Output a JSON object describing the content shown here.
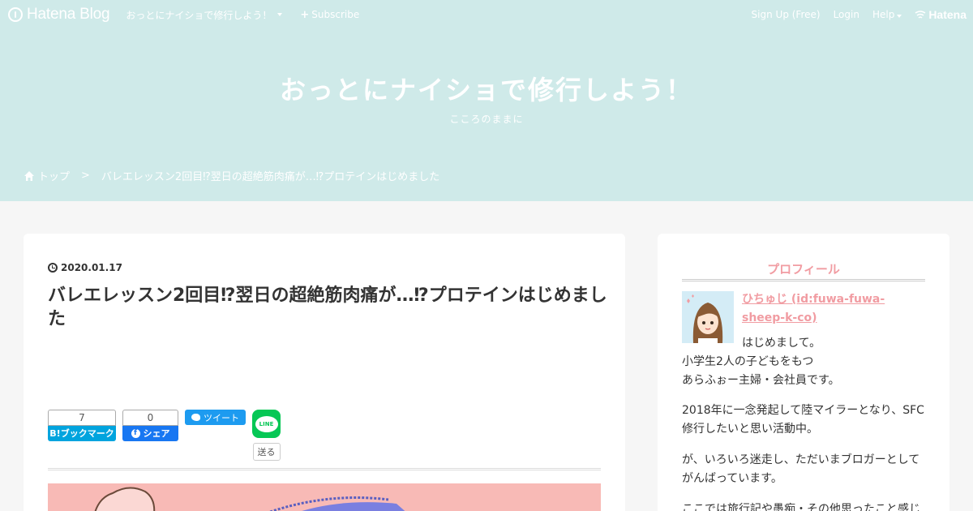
{
  "topbar": {
    "brand": "Hatena Blog",
    "blog_name": "おっとにナイショで修行しよう！",
    "subscribe": "Subscribe",
    "signup": "Sign Up (Free)",
    "login": "Login",
    "help": "Help",
    "hatena": "Hatena"
  },
  "header": {
    "title": "おっとにナイショで修行しよう！",
    "description": "こころのままに"
  },
  "breadcrumb": {
    "home": "トップ",
    "separator": ">",
    "current": "バレエレッスン2回目⁉翌日の超絶筋肉痛が…⁉プロテインはじめました"
  },
  "entry": {
    "date": "2020.01.17",
    "title": "バレエレッスン2回目⁉翌日の超絶筋肉痛が…⁉プロテインはじめました"
  },
  "share": {
    "hatena_count": "7",
    "hatena_label": "B!ブックマーク",
    "fb_count": "0",
    "fb_label": "シェア",
    "tweet_label": "ツイート",
    "line_label": "LINE",
    "send_label": "送る"
  },
  "sidebar": {
    "title": "プロフィール",
    "name": "ひちゅじ (id:fuwa-fuwa-sheep-k-co)",
    "line1": "はじめまして。",
    "line2": "小学生2人の子どもをもつ",
    "line3": "あらふぉー主婦・会社員です。",
    "para2": "2018年に一念発起して陸マイラーとなり、SFC修行したいと思い活動中。",
    "para3": "が、いろいろ迷走し、ただいまブロガーとしてがんばっています。",
    "para4": "ここでは旅行記や愚痴・その他思ったこと感じ"
  },
  "colors": {
    "header_bg": "#cfeae9",
    "accent_pink": "#f19ca2",
    "hatena_blue": "#00a4de",
    "facebook_blue": "#1877f2",
    "twitter_blue": "#1d9bf0",
    "line_green": "#06c755"
  }
}
